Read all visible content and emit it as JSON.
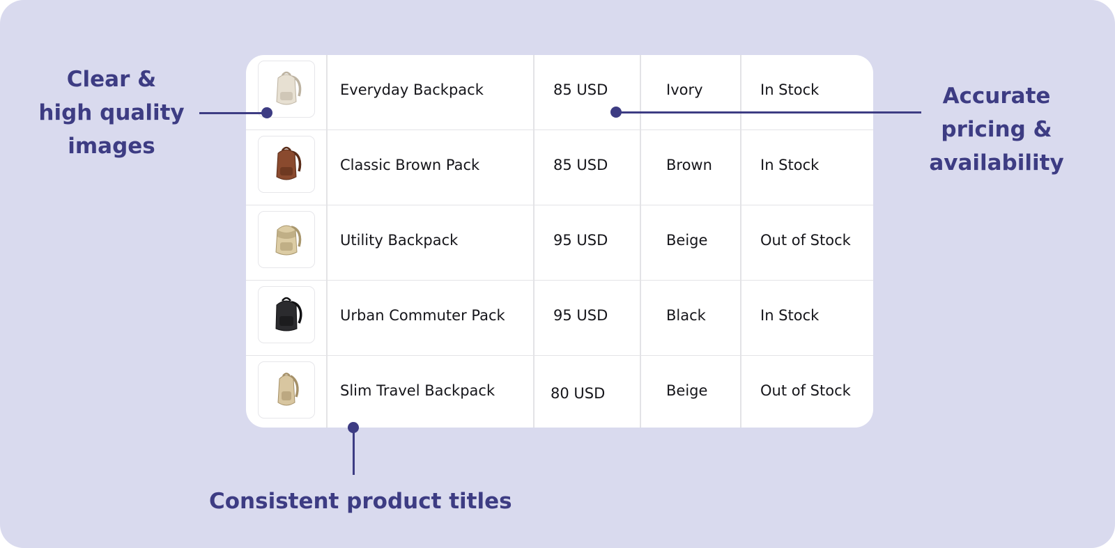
{
  "callouts": {
    "images": [
      "Clear &",
      "high quality",
      "images"
    ],
    "pricing": [
      "Accurate",
      "pricing &",
      "availability"
    ],
    "titles": "Consistent product titles"
  },
  "colors": {
    "background": "#d9daee",
    "accent": "#3d3c83",
    "card": "#ffffff"
  },
  "products": [
    {
      "name": "Everyday Backpack",
      "price": "85 USD",
      "color": "Ivory",
      "stock": "In Stock",
      "image": "ivory-backpack-icon",
      "tint": "#e7e0d2",
      "dark": "#bdb3a1"
    },
    {
      "name": "Classic Brown Pack",
      "price": "85 USD",
      "color": "Brown",
      "stock": "In Stock",
      "image": "brown-backpack-icon",
      "tint": "#8a4a2e",
      "dark": "#5a2c18"
    },
    {
      "name": "Utility Backpack",
      "price": "95 USD",
      "color": "Beige",
      "stock": "Out of Stock",
      "image": "beige-backpack-icon",
      "tint": "#dccca4",
      "dark": "#a9976d"
    },
    {
      "name": "Urban Commuter Pack",
      "price": "95 USD",
      "color": "Black",
      "stock": "In Stock",
      "image": "black-backpack-icon",
      "tint": "#2b2b2e",
      "dark": "#111113"
    },
    {
      "name": "Slim Travel Backpack",
      "price": "80 USD",
      "color": "Beige",
      "stock": "Out of Stock",
      "image": "beige-sling-backpack-icon",
      "tint": "#d8c6a0",
      "dark": "#a59068"
    }
  ]
}
